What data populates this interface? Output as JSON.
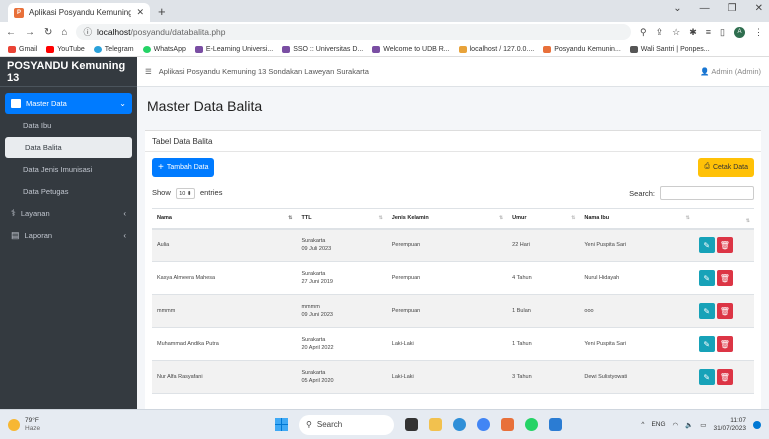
{
  "browser": {
    "tab_title": "Aplikasi Posyandu Kemuning 13",
    "url_host": "localhost",
    "url_path": "/posyandu/databalita.php",
    "bookmarks": [
      "Gmail",
      "YouTube",
      "Telegram",
      "WhatsApp",
      "E-Learning Universi...",
      "SSO :: Universitas D...",
      "Welcome to UDB R...",
      "localhost / 127.0.0....",
      "Posyandu Kemunin...",
      "Wali Santri | Ponpes..."
    ]
  },
  "sidebar": {
    "brand": "POSYANDU Kemuning 13",
    "master_label": "Master Data",
    "sub_items": [
      "Data Ibu",
      "Data Balita",
      "Data Jenis Imunisasi",
      "Data Petugas"
    ],
    "layanan_label": "Layanan",
    "laporan_label": "Laporan"
  },
  "topbar": {
    "app_title": "Aplikasi Posyandu Kemuning 13 Sondakan Laweyan Surakarta",
    "user": "Admin (Admin)"
  },
  "page": {
    "title": "Master Data Balita",
    "card_title": "Tabel Data Balita",
    "add_button": "Tambah Data",
    "print_button": "Cetak Data",
    "show_label": "Show",
    "entries_value": "10",
    "entries_label": "entries",
    "search_label": "Search:"
  },
  "table": {
    "headers": [
      "Nama",
      "TTL",
      "Jenis Kelamin",
      "Umur",
      "Nama Ibu",
      ""
    ],
    "rows": [
      {
        "nama": "Aulia",
        "ttl_place": "Surakarta",
        "ttl_date": "09 Juli 2023",
        "jk": "Perempuan",
        "umur": "22 Hari",
        "ibu": "Yeni Puspita Sari"
      },
      {
        "nama": "Kasya Almeera Mahesa",
        "ttl_place": "Surakarta",
        "ttl_date": "27 Juni 2019",
        "jk": "Perempuan",
        "umur": "4 Tahun",
        "ibu": "Nurul Hidayah"
      },
      {
        "nama": "mmmm",
        "ttl_place": "mmmm",
        "ttl_date": "09 Juni 2023",
        "jk": "Perempuan",
        "umur": "1 Bulan",
        "ibu": "ooo"
      },
      {
        "nama": "Muhammad Andika Putra",
        "ttl_place": "Surakarta",
        "ttl_date": "20 April 2022",
        "jk": "Laki-Laki",
        "umur": "1 Tahun",
        "ibu": "Yeni Puspita Sari"
      },
      {
        "nama": "Nur Alfa Rasyafani",
        "ttl_place": "Surakarta",
        "ttl_date": "05 April 2020",
        "jk": "Laki-Laki",
        "umur": "3 Tahun",
        "ibu": "Dewi Sulistyowati"
      }
    ]
  },
  "taskbar": {
    "temp": "79°F",
    "weather": "Haze",
    "search": "Search",
    "lang": "ENG",
    "time": "11:07",
    "date": "31/07/2023"
  }
}
